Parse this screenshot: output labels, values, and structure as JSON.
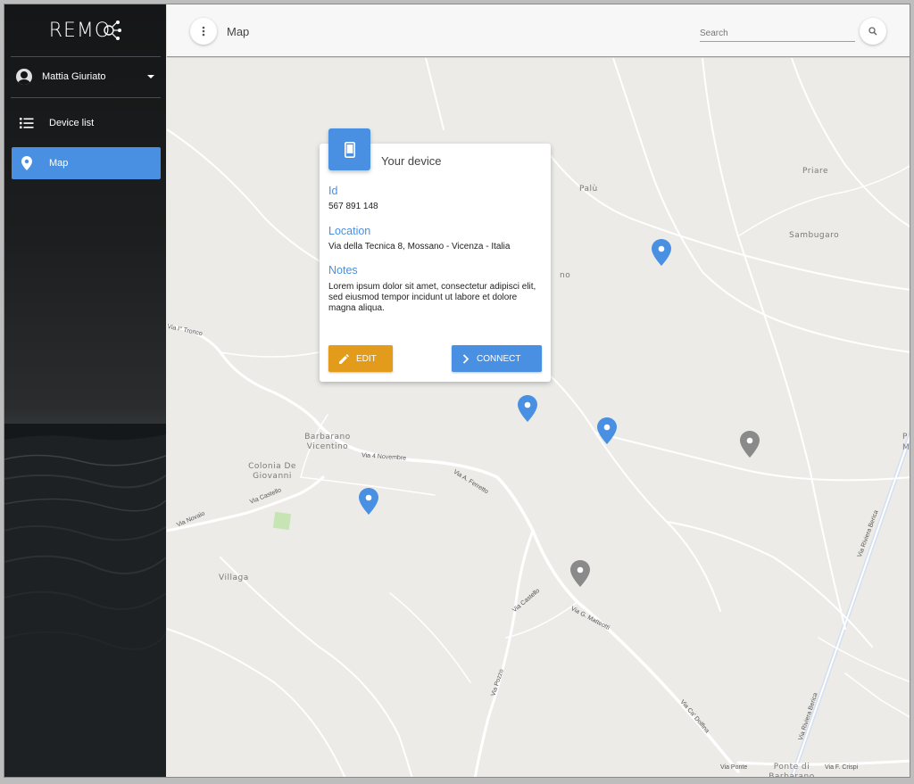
{
  "app": {
    "logo_text": "REMO"
  },
  "user": {
    "name": "Mattia Giuriato"
  },
  "nav": {
    "items": [
      {
        "label": "Device list",
        "icon": "list-icon"
      },
      {
        "label": "Map",
        "icon": "map-pin-icon",
        "active": true
      }
    ]
  },
  "header": {
    "title": "Map",
    "search_placeholder": "Search",
    "menu_icon": "more-vertical-icon",
    "search_icon": "search-icon"
  },
  "device_card": {
    "title": "Your device",
    "icon": "smartphone-icon",
    "id_label": "Id",
    "id_value": "567 891 148",
    "location_label": "Location",
    "location_value": "Via della Tecnica 8, Mossano - Vicenza - Italia",
    "notes_label": "Notes",
    "notes_value": "Lorem ipsum dolor sit amet, consectetur adipisci elit, sed eiusmod tempor incidunt ut labore et dolore magna aliqua.",
    "edit_label": "EDIT",
    "connect_label": "CONNECT"
  },
  "map": {
    "places": [
      "Priare",
      "Palù",
      "Sambugaro",
      "Barbarano Vicentino",
      "Colonia De Giovanni",
      "Villaga",
      "Ponte di Barbarano"
    ],
    "partial_labels": [
      "no",
      "P",
      "M"
    ],
    "streets": [
      "Via I° Tronco",
      "Via 4 Novembre",
      "Via A. Ferretto",
      "Via Castello",
      "Via Novaio",
      "Via G. Matteotti",
      "Via Pozzo",
      "Via Ca' Dolfina",
      "Via Riviera Berica",
      "Via Ponte",
      "Via F. Crispi"
    ],
    "colors": {
      "pin_active": "#4a90e2",
      "pin_inactive": "#8a8a8a",
      "accent": "#4a90e2",
      "edit": "#e39b1c"
    }
  }
}
